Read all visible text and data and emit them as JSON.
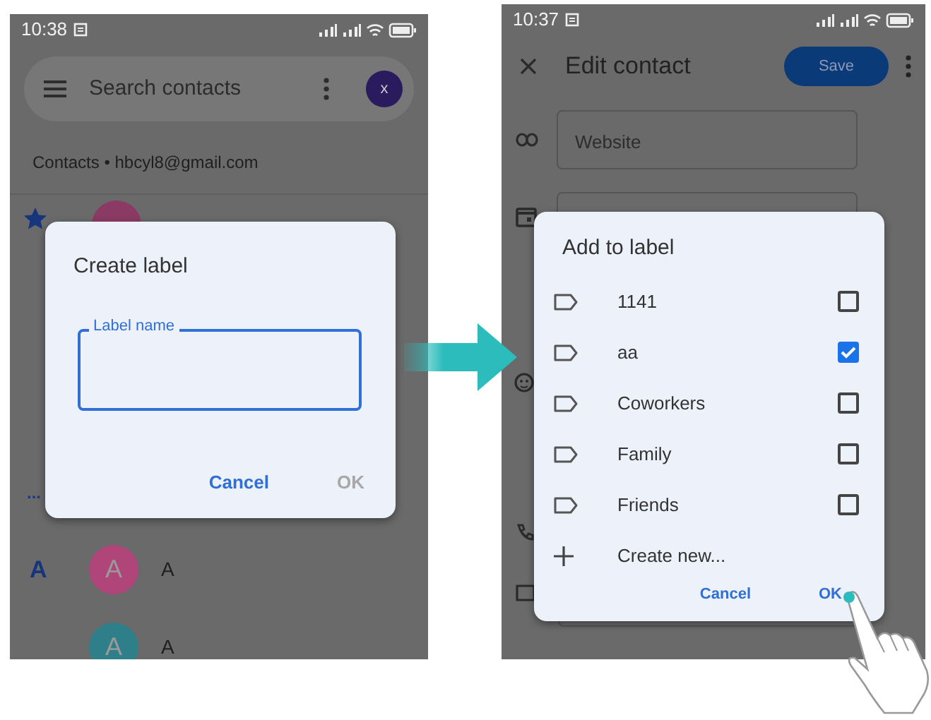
{
  "left_screen": {
    "status_bar": {
      "time": "10:38"
    },
    "search": {
      "placeholder": "Search contacts"
    },
    "account_avatar": "x",
    "account_line": "Contacts • hbcyl8@gmail.com",
    "overflow_mark": "...",
    "contacts": [
      {
        "section": "A",
        "initial": "A",
        "name": "A",
        "color": "#b0457a"
      },
      {
        "initial": "A",
        "name": "A",
        "color": "#2f7f8a"
      }
    ],
    "dialog": {
      "title": "Create label",
      "field_label": "Label name",
      "buttons": [
        {
          "label": "Cancel",
          "disabled": false
        },
        {
          "label": "OK",
          "disabled": true
        }
      ]
    }
  },
  "right_screen": {
    "status_bar": {
      "time": "10:37"
    },
    "toolbar": {
      "title": "Edit contact",
      "save": "Save"
    },
    "fields": [
      {
        "placeholder": "Website"
      }
    ],
    "dialog": {
      "title": "Add to label",
      "labels": [
        {
          "name": "1141",
          "checked": false
        },
        {
          "name": "aa",
          "checked": true
        },
        {
          "name": "Coworkers",
          "checked": false
        },
        {
          "name": "Family",
          "checked": false
        },
        {
          "name": "Friends",
          "checked": false
        }
      ],
      "create": "Create new...",
      "buttons": [
        {
          "label": "Cancel",
          "disabled": false
        },
        {
          "label": "OK",
          "disabled": false
        }
      ]
    }
  }
}
